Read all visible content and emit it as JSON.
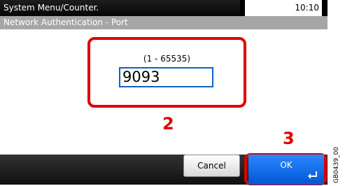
{
  "header": {
    "menu_title": "System Menu/Counter.",
    "time": "10:10",
    "subtitle": "Network Authentication - Port"
  },
  "form": {
    "range": "(1 - 65535)",
    "port_value": "9093"
  },
  "annotations": {
    "step_input": "2",
    "step_ok": "3",
    "figure_code": "GB0439_00"
  },
  "buttons": {
    "cancel": "Cancel",
    "ok": "OK",
    "ok_icon": "enter-icon"
  },
  "colors": {
    "highlight": "#e00000",
    "ok_button": "#0b6ef0",
    "field_border": "#1060c8"
  }
}
